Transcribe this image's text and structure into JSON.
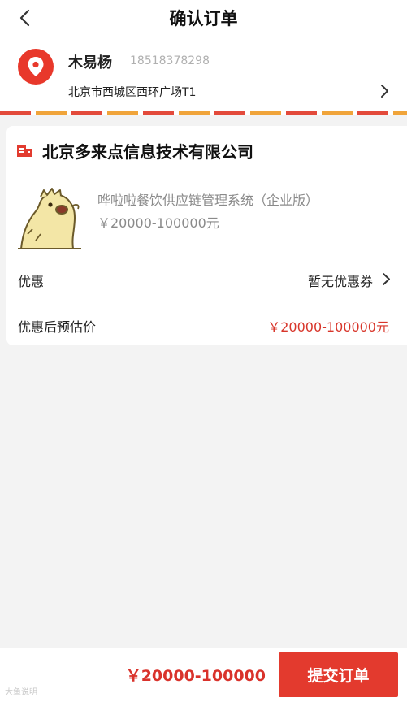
{
  "header": {
    "title": "确认订单"
  },
  "address": {
    "name": "木易杨",
    "phone": "18518378298",
    "detail": "北京市西城区西环广场T1"
  },
  "shop": {
    "name": "北京多来点信息技术有限公司"
  },
  "product": {
    "name": "哗啦啦餐饮供应链管理系统（企业版）",
    "price": "￥20000-100000元"
  },
  "discount": {
    "label": "优惠",
    "value": "暂无优惠券"
  },
  "estimate": {
    "label": "优惠后预估价",
    "value": "￥20000-100000元"
  },
  "footer": {
    "total": "￥20000-100000",
    "submit_label": "提交订单"
  },
  "watermark": "大鱼说明",
  "colors": {
    "accent": "#e33a2e",
    "price": "#d8362b",
    "stripe_orange": "#f0a43a"
  }
}
